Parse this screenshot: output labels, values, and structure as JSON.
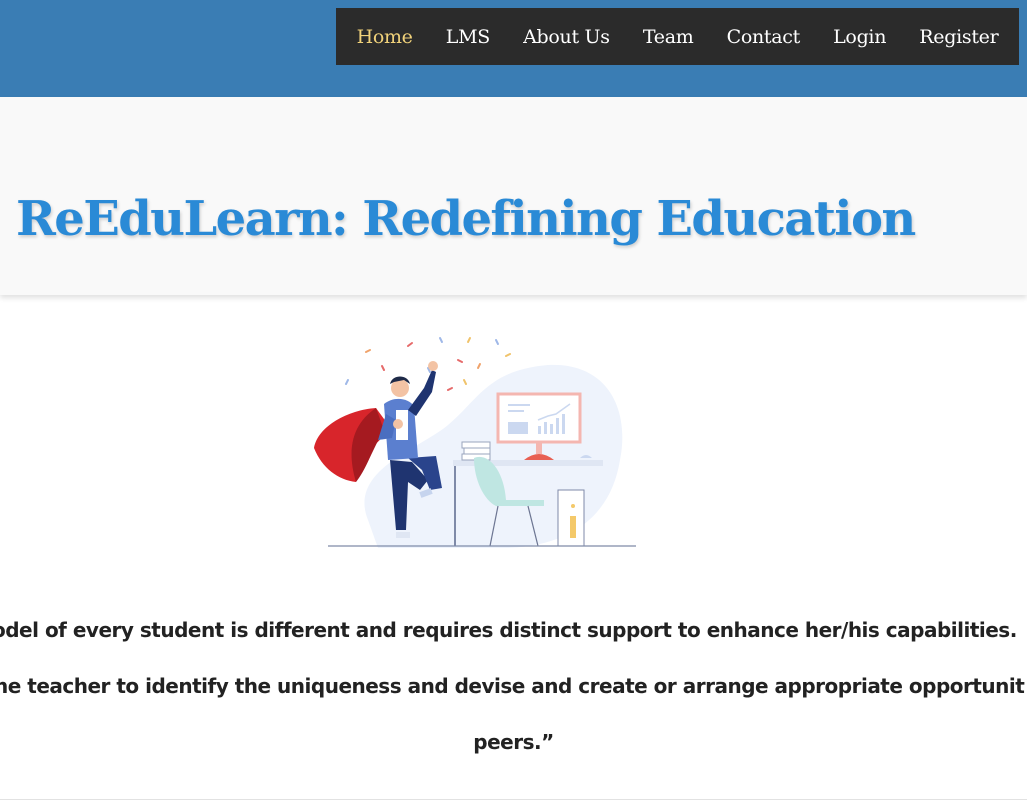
{
  "nav": {
    "items": [
      {
        "label": "Home",
        "active": true
      },
      {
        "label": "LMS",
        "active": false
      },
      {
        "label": "About Us",
        "active": false
      },
      {
        "label": "Team",
        "active": false
      },
      {
        "label": "Contact",
        "active": false
      },
      {
        "label": "Login",
        "active": false
      },
      {
        "label": "Register",
        "active": false
      }
    ]
  },
  "hero": {
    "title": "ReEduLearn: Redefining Education"
  },
  "illustration": {
    "icon": "superhero-at-desk-illustration"
  },
  "quote": {
    "lines": [
      "odel of every student is different and requires distinct support to enhance her/his capabilities.",
      "he teacher to identify the uniqueness and devise and create or arrange appropriate opportunit",
      "peers.”"
    ]
  },
  "colors": {
    "topbar": "#3a7db4",
    "nav_bg": "#2b2b2b",
    "nav_active": "#f1d27a",
    "title": "#2a8ad6"
  }
}
